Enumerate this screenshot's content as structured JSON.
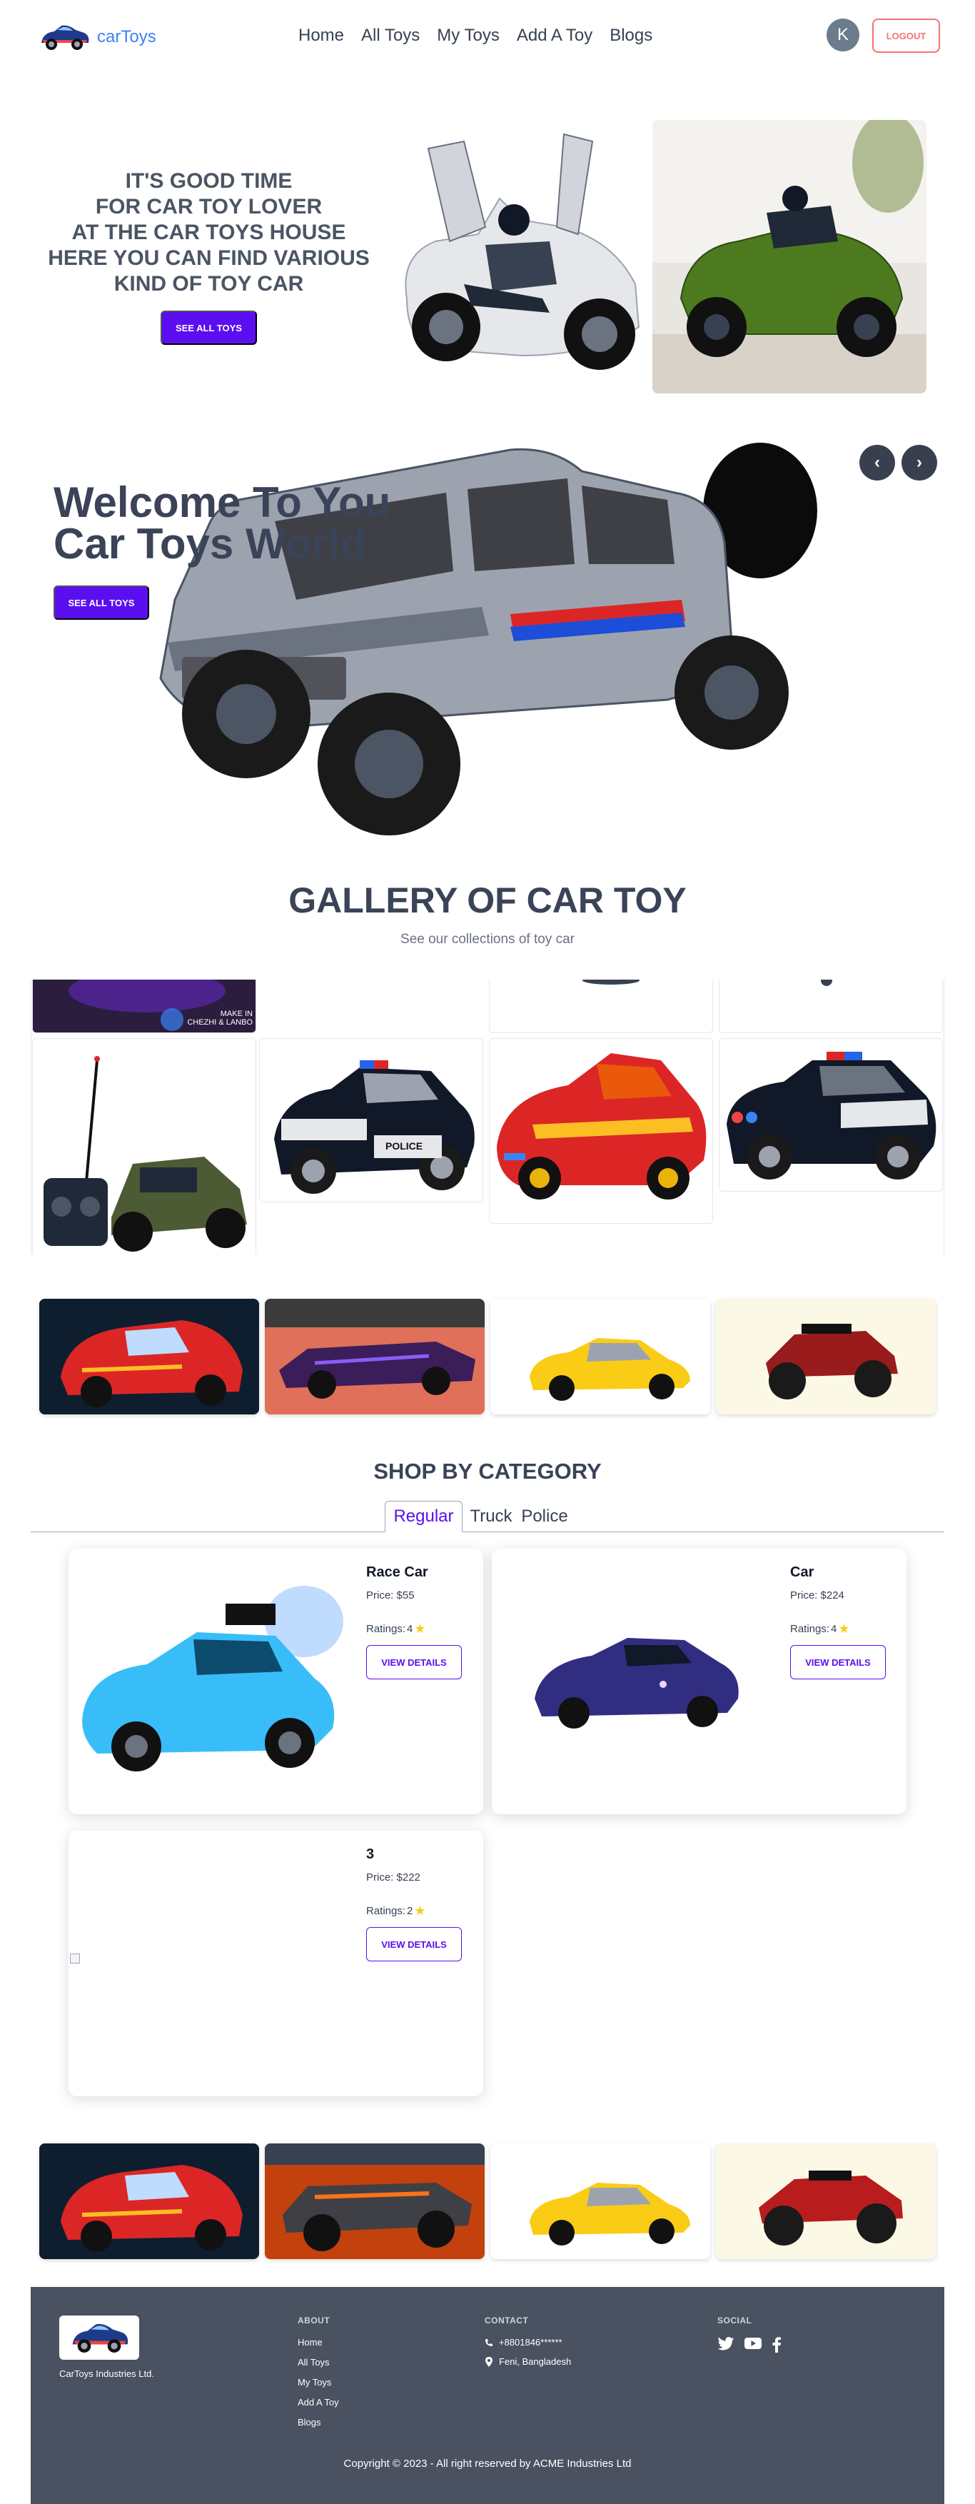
{
  "header": {
    "logo_text": "carToys",
    "nav": [
      "Home",
      "All Toys",
      "My Toys",
      "Add A Toy",
      "Blogs"
    ],
    "avatar_initial": "K",
    "logout_label": "LOGOUT"
  },
  "hero": {
    "lines": [
      "IT'S GOOD TIME",
      "FOR CAR TOY LOVER",
      "AT THE CAR TOYS HOUSE",
      "HERE YOU CAN FIND VARIOUS",
      "KIND OF TOY CAR"
    ],
    "button_label": "SEE ALL TOYS"
  },
  "slider": {
    "title_line1": "Welcome To You",
    "title_line2": "Car Toys World",
    "button_label": "SEE ALL TOYS",
    "prev_label": "‹",
    "next_label": "›"
  },
  "gallery": {
    "title": "GALLERY OF CAR TOY",
    "subtitle": "See our collections of toy car",
    "watermark_line1": "MAKE IN",
    "watermark_line2": "CHEZHI & LANBO",
    "police_label": "POLICE"
  },
  "category": {
    "title": "SHOP BY CATEGORY",
    "tabs": [
      "Regular",
      "Truck",
      "Police"
    ],
    "price_prefix": "Price: ",
    "ratings_prefix": "Ratings: ",
    "products": [
      {
        "name": "Race Car",
        "price": "$55",
        "rating": "4",
        "button": "VIEW DETAILS"
      },
      {
        "name": "Car",
        "price": "$224",
        "rating": "4",
        "button": "VIEW DETAILS"
      },
      {
        "name": "3",
        "price": "$222",
        "rating": "2",
        "button": "VIEW DETAILS"
      }
    ]
  },
  "footer": {
    "company": "CarToys Industries Ltd.",
    "about_heading": "ABOUT",
    "about_links": [
      "Home",
      "All Toys",
      "My Toys",
      "Add A Toy",
      "Blogs"
    ],
    "contact_heading": "CONTACT",
    "phone": "+8801846******",
    "location": "Feni, Bangladesh",
    "social_heading": "SOCIAL",
    "copyright": "Copyright © 2023 - All right reserved by ACME Industries Ltd"
  },
  "colors": {
    "accent": "#5b0ff0",
    "logo_blue": "#3b82f6",
    "logout_red": "#f87171",
    "heading": "#3a4357",
    "footer_bg": "#4a5160"
  }
}
